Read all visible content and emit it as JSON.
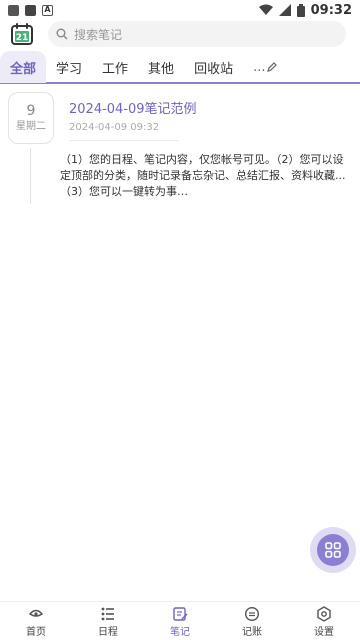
{
  "status_bar": {
    "time": "09:32",
    "icons": [
      "image-icon",
      "square-icon",
      "a-icon",
      "wifi-icon",
      "signal-icon",
      "battery-icon"
    ]
  },
  "header": {
    "logo_text": "21",
    "search_placeholder": "搜索笔记"
  },
  "tabs": [
    {
      "label": "全部",
      "active": true
    },
    {
      "label": "学习",
      "active": false
    },
    {
      "label": "工作",
      "active": false
    },
    {
      "label": "其他",
      "active": false
    },
    {
      "label": "回收站",
      "active": false
    }
  ],
  "tab_more": "...",
  "notes": [
    {
      "day": "9",
      "weekday": "星期二",
      "title": "2024-04-09笔记范例",
      "timestamp": "2024-04-09 09:32",
      "content": "（1）您的日程、笔记内容，仅您帐号可见。（2）您可以设定顶部的分类，随时记录备忘杂记、总结汇报、资料收藏...（3）您可以一键转为事…"
    }
  ],
  "bottom_nav": [
    {
      "label": "首页",
      "icon": "home-icon",
      "active": false
    },
    {
      "label": "日程",
      "icon": "schedule-icon",
      "active": false
    },
    {
      "label": "笔记",
      "icon": "note-icon",
      "active": true
    },
    {
      "label": "记账",
      "icon": "ledger-icon",
      "active": false
    },
    {
      "label": "设置",
      "icon": "settings-icon",
      "active": false
    }
  ],
  "colors": {
    "accent": "#6d63c3",
    "accent_light": "#ecebf7",
    "fab_outer": "#dedbf3",
    "fab_inner": "#8b7fd1"
  }
}
